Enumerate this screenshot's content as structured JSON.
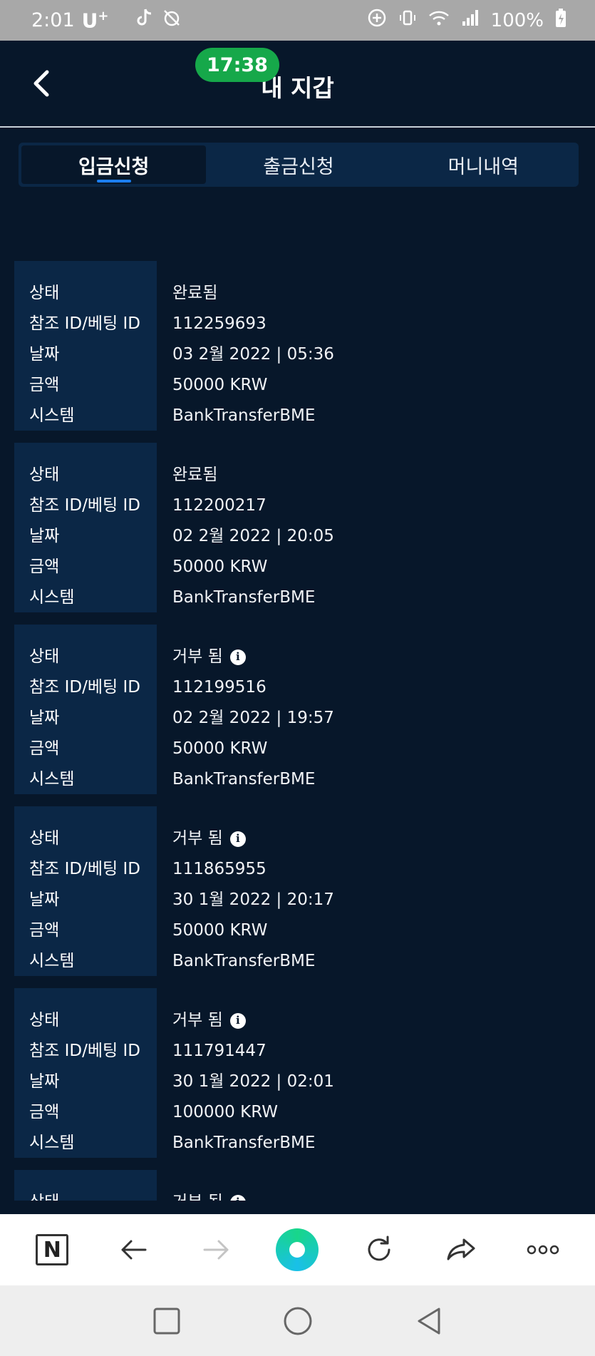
{
  "status_bar": {
    "time": "2:01",
    "carrier": "U",
    "carrier_sup": "+",
    "battery": "100%"
  },
  "header": {
    "title": "내 지갑",
    "timer": "17:38"
  },
  "tabs": [
    {
      "label": "입금신청",
      "active": true
    },
    {
      "label": "출금신청",
      "active": false
    },
    {
      "label": "머니내역",
      "active": false
    }
  ],
  "field_labels": {
    "status": "상태",
    "ref_id": "참조 ID/베팅 ID",
    "date": "날짜",
    "amount": "금액",
    "system": "시스템"
  },
  "transactions": [
    {
      "status": "완료됨",
      "ref_id": "112259693",
      "date": "03 2월 2022 | 05:36",
      "amount": "50000 KRW",
      "system": "BankTransferBME",
      "info": false
    },
    {
      "status": "완료됨",
      "ref_id": "112200217",
      "date": "02 2월 2022 | 20:05",
      "amount": "50000 KRW",
      "system": "BankTransferBME",
      "info": false
    },
    {
      "status": "거부 됨",
      "ref_id": "112199516",
      "date": "02 2월 2022 | 19:57",
      "amount": "50000 KRW",
      "system": "BankTransferBME",
      "info": true
    },
    {
      "status": "거부 됨",
      "ref_id": "111865955",
      "date": "30 1월 2022 | 20:17",
      "amount": "50000 KRW",
      "system": "BankTransferBME",
      "info": true
    },
    {
      "status": "거부 됨",
      "ref_id": "111791447",
      "date": "30 1월 2022 | 02:01",
      "amount": "100000 KRW",
      "system": "BankTransferBME",
      "info": true
    },
    {
      "status": "거부 됨",
      "ref_id": "",
      "date": "",
      "amount": "",
      "system": "",
      "info": true
    }
  ],
  "browser_bar": {
    "icons": [
      "naver-icon",
      "back-arrow-icon",
      "forward-arrow-icon",
      "home-dot-icon",
      "refresh-icon",
      "share-icon",
      "more-icon"
    ]
  },
  "nav_bar": {
    "icons": [
      "recent-apps-icon",
      "home-icon",
      "back-icon"
    ]
  }
}
